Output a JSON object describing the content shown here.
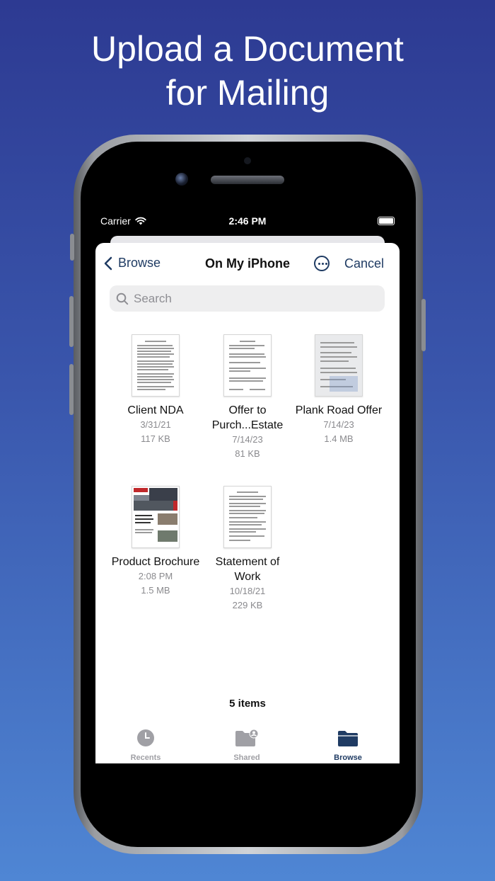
{
  "headline": {
    "line1": "Upload a Document",
    "line2": "for Mailing"
  },
  "status": {
    "carrier": "Carrier",
    "time": "2:46 PM"
  },
  "nav": {
    "back_label": "Browse",
    "title": "On My iPhone",
    "cancel_label": "Cancel"
  },
  "search": {
    "placeholder": "Search"
  },
  "files": [
    {
      "name": "Client NDA",
      "date": "3/31/21",
      "size": "117 KB"
    },
    {
      "name": "Offer to Purch...Estate",
      "date": "7/14/23",
      "size": "81 KB"
    },
    {
      "name": "Plank Road Offer",
      "date": "7/14/23",
      "size": "1.4 MB"
    },
    {
      "name": "Product Brochure",
      "date": "2:08 PM",
      "size": "1.5 MB"
    },
    {
      "name": "Statement of Work",
      "date": "10/18/21",
      "size": "229 KB"
    }
  ],
  "footer": {
    "count": "5 items"
  },
  "tabs": [
    {
      "label": "Recents",
      "icon": "clock-icon",
      "active": false
    },
    {
      "label": "Shared",
      "icon": "shared-folder-icon",
      "active": false
    },
    {
      "label": "Browse",
      "icon": "folder-icon",
      "active": true
    }
  ],
  "colors": {
    "accent": "#1f3b63",
    "background_top": "#2d3a92",
    "background_bottom": "#4f86d4"
  }
}
